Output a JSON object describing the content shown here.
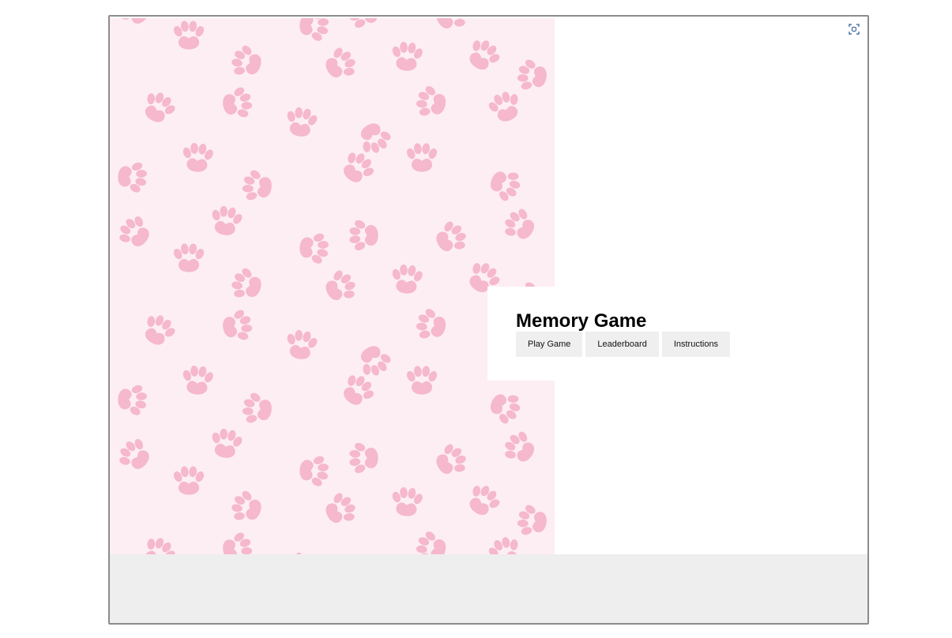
{
  "game": {
    "title": "Memory Game",
    "buttons": {
      "play": "Play Game",
      "leaderboard": "Leaderboard",
      "instructions": "Instructions"
    }
  },
  "theme": {
    "pattern_background": "#fdeef3",
    "paw_color": "#f5b8cd",
    "bottom_bar": "#eeeeee",
    "frame_border": "#8c8c8c",
    "button_bg": "#efefef"
  },
  "icons": {
    "fullscreen": "fullscreen-icon",
    "pattern": "paw-print-icon"
  }
}
